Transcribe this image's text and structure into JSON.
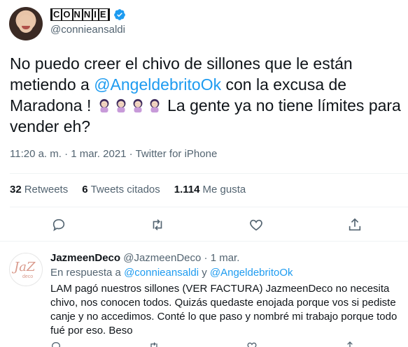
{
  "tweet": {
    "display_name_letters": [
      "C",
      "O",
      "N",
      "N",
      "I",
      "E"
    ],
    "handle": "@connieansaldi",
    "text_part1": "No puedo creer el chivo de sillones que le están metiendo a ",
    "mention": "@AngeldebritoOk",
    "text_part2": " con la excusa de Maradona ! ",
    "text_part3": " La gente ya no tiene límites para vender eh?",
    "emoji_icon": "woman-facepalming-emoji",
    "time": "11:20 a. m.",
    "separator": " · ",
    "date": "1 mar. 2021",
    "source": "Twitter for iPhone",
    "stats": {
      "retweets_count": "32",
      "retweets_label": "Retweets",
      "quotes_count": "6",
      "quotes_label": "Tweets citados",
      "likes_count": "1.114",
      "likes_label": "Me gusta"
    }
  },
  "reply": {
    "name": "JazmeenDeco",
    "handle": "@JazmeenDeco",
    "sep": " · ",
    "date": "1 mar.",
    "replying_prefix": "En respuesta a ",
    "replying_user1": "@connieansaldi",
    "replying_and": " y ",
    "replying_user2": "@AngeldebritoOk",
    "text": "LAM pagó nuestros sillones (VER FACTURA) JazmeenDeco no necesita chivo, nos conocen todos. Quizás quedaste enojada porque vos si pediste canje y no accedimos. Conté lo que paso y nombré mi trabajo porque todo fué por eso. Beso",
    "avatar_logo": "JaZ meen deco"
  },
  "colors": {
    "accent": "#1d9bf0",
    "muted": "#536471",
    "text": "#0f1419",
    "divider": "#eff3f4"
  }
}
